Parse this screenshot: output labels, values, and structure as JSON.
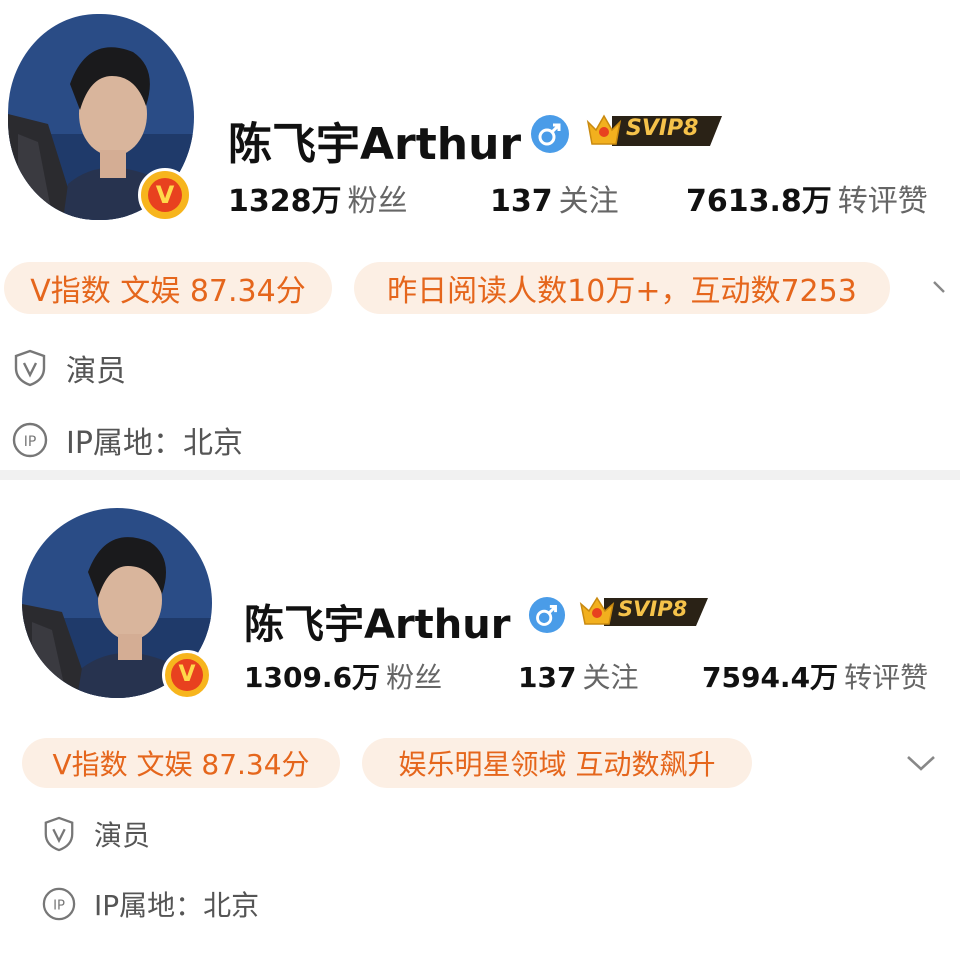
{
  "profiles": [
    {
      "name": "陈飞宇Arthur",
      "gender_icon": "male-icon",
      "vip_badge": "SVIP8",
      "verified_badge": "V",
      "stats": [
        {
          "value": "1328万",
          "label": "粉丝"
        },
        {
          "value": "137",
          "label": "关注"
        },
        {
          "value": "7613.8万",
          "label": "转评赞"
        }
      ],
      "tags": [
        "V指数 文娱 87.34分",
        "昨日阅读人数10万+，互动数7253"
      ],
      "info": [
        {
          "icon": "shield-v-icon",
          "text": "演员"
        },
        {
          "icon": "ip-icon",
          "text": "IP属地：北京"
        }
      ]
    },
    {
      "name": "陈飞宇Arthur",
      "gender_icon": "male-icon",
      "vip_badge": "SVIP8",
      "verified_badge": "V",
      "stats": [
        {
          "value": "1309.6万",
          "label": "粉丝"
        },
        {
          "value": "137",
          "label": "关注"
        },
        {
          "value": "7594.4万",
          "label": "转评赞"
        }
      ],
      "tags": [
        "V指数 文娱 87.34分",
        "娱乐明星领域 互动数飙升"
      ],
      "info": [
        {
          "icon": "shield-v-icon",
          "text": "演员"
        },
        {
          "icon": "ip-icon",
          "text": "IP属地：北京"
        }
      ]
    }
  ],
  "colors": {
    "tag_bg": "#fcefe4",
    "tag_text": "#e5661c",
    "gender_blue": "#4a9ce8",
    "vip_gold": "#f2b01e",
    "verified_red": "#e8411f"
  }
}
